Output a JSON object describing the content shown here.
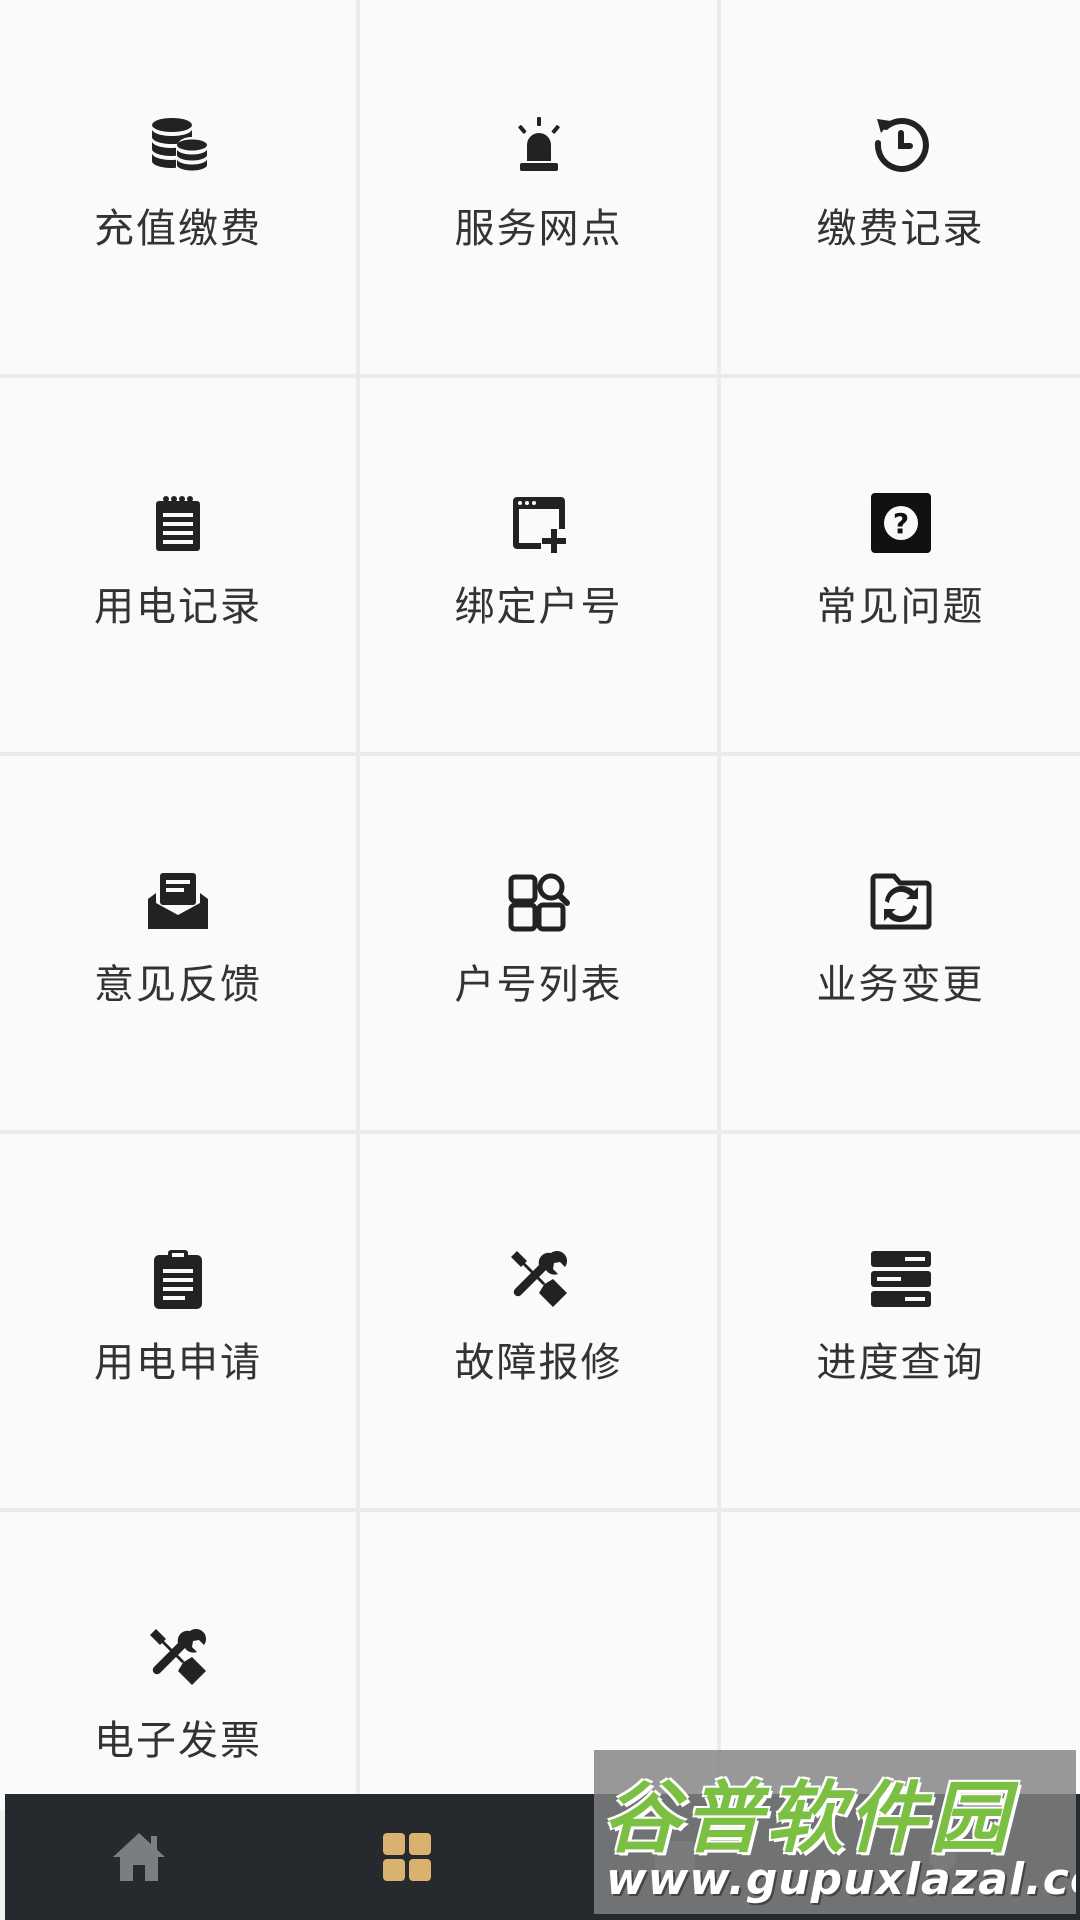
{
  "grid": {
    "items": [
      {
        "label": "充值缴费",
        "icon": "database-coins-icon"
      },
      {
        "label": "服务网点",
        "icon": "alarm-light-icon"
      },
      {
        "label": "缴费记录",
        "icon": "history-clock-icon"
      },
      {
        "label": "用电记录",
        "icon": "notepad-icon"
      },
      {
        "label": "绑定户号",
        "icon": "window-add-icon"
      },
      {
        "label": "常见问题",
        "icon": "question-box-icon"
      },
      {
        "label": "意见反馈",
        "icon": "open-mail-icon"
      },
      {
        "label": "户号列表",
        "icon": "apps-search-icon"
      },
      {
        "label": "业务变更",
        "icon": "folder-sync-icon"
      },
      {
        "label": "用电申请",
        "icon": "clipboard-text-icon"
      },
      {
        "label": "故障报修",
        "icon": "tools-icon"
      },
      {
        "label": "进度查询",
        "icon": "server-stack-icon"
      },
      {
        "label": "电子发票",
        "icon": "tools-icon"
      }
    ]
  },
  "tabbar": {
    "tabs": [
      {
        "name": "home",
        "icon": "home-icon",
        "active": false
      },
      {
        "name": "services",
        "icon": "grid-icon",
        "active": true
      },
      {
        "name": "tab3",
        "icon": "tab-icon",
        "active": false
      },
      {
        "name": "tab4",
        "icon": "tab-icon",
        "active": false
      }
    ],
    "active_color": "#d8b26e",
    "inactive_color": "#7a7d82",
    "background": "#26292e"
  },
  "watermark": {
    "title": "谷普软件园",
    "url": "www.gupuxlazal.com"
  }
}
